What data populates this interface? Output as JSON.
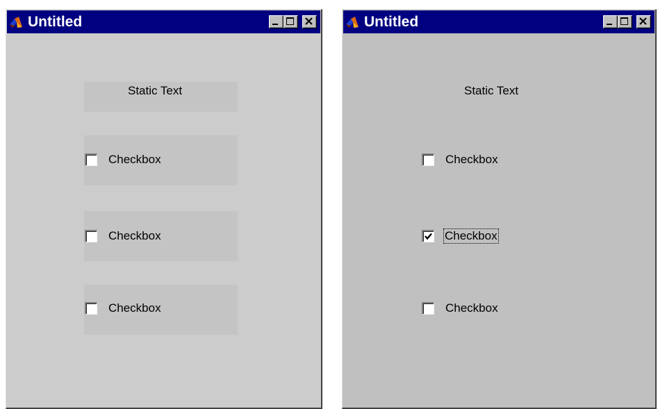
{
  "windows": [
    {
      "title": "Untitled",
      "static_text": "Static Text",
      "checkboxes": [
        {
          "label": "Checkbox",
          "checked": false
        },
        {
          "label": "Checkbox",
          "checked": false
        },
        {
          "label": "Checkbox",
          "checked": false
        }
      ]
    },
    {
      "title": "Untitled",
      "static_text": "Static Text",
      "checkboxes": [
        {
          "label": "Checkbox",
          "checked": false
        },
        {
          "label": "Checkbox",
          "checked": true,
          "focused": true
        },
        {
          "label": "Checkbox",
          "checked": false
        }
      ]
    }
  ],
  "colors": {
    "titlebar": "#000080",
    "window_bg_left": "#cccccc",
    "window_bg_right": "#c0c0c0",
    "control_bg": "#c4c4c4"
  },
  "icons": {
    "app": "matlab-logo-icon",
    "minimize": "minimize-icon",
    "maximize": "maximize-icon",
    "close": "close-icon"
  }
}
